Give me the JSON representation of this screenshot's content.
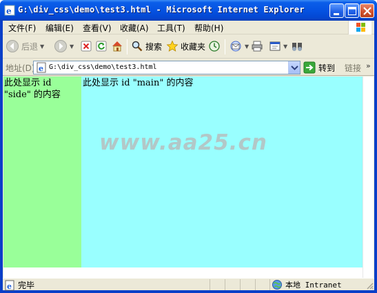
{
  "window": {
    "title": "G:\\div_css\\demo\\test3.html - Microsoft Internet Explorer"
  },
  "menu": {
    "items": [
      "文件(F)",
      "编辑(E)",
      "查看(V)",
      "收藏(A)",
      "工具(T)",
      "帮助(H)"
    ]
  },
  "toolbar": {
    "back_label": "后退",
    "search_label": "搜索",
    "favorites_label": "收藏夹"
  },
  "address": {
    "label": "地址(D)",
    "url": "G:\\div_css\\demo\\test3.html",
    "go_label": "转到",
    "links_label": "链接"
  },
  "page": {
    "side_text": "此处显示 id \"side\" 的内容",
    "main_text": "此处显示 id \"main\" 的内容",
    "watermark": "www.aa25.cn",
    "side_color": "#99ff99",
    "main_color": "#99ffff"
  },
  "status": {
    "text": "完毕",
    "zone": "本地 Intranet"
  },
  "icons": [
    "ie-icon",
    "minimize-icon",
    "maximize-icon",
    "close-icon",
    "windows-flag-icon",
    "back-icon",
    "forward-icon",
    "stop-icon",
    "refresh-icon",
    "home-icon",
    "search-icon",
    "favorites-star-icon",
    "history-icon",
    "mail-icon",
    "print-icon",
    "edit-icon",
    "research-icon",
    "page-icon",
    "go-arrow-icon",
    "done-page-icon",
    "intranet-globe-icon"
  ]
}
